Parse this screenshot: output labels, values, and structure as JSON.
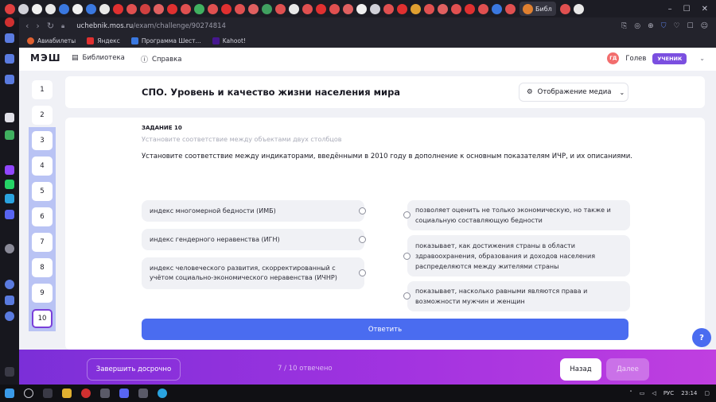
{
  "browser": {
    "active_tab_label": "Библ",
    "url_host": "uchebnik.mos.ru",
    "url_path": "/exam/challenge/90274814",
    "bookmarks": [
      "Авиабилеты",
      "Яндекс",
      "Программа Шест...",
      "Kahoot!"
    ]
  },
  "site": {
    "logo": "МЭШ",
    "nav": {
      "library": "Библиотека",
      "help": "Справка"
    },
    "user": {
      "initials": "ГД",
      "name": "Голев",
      "role": "УЧЕНИК"
    }
  },
  "question_nav": {
    "items": [
      "1",
      "2",
      "3",
      "4",
      "5",
      "6",
      "7",
      "8",
      "9",
      "10"
    ],
    "current": "10"
  },
  "title": "СПО. Уровень и качество жизни населения мира",
  "media_button": "Отображение медиа",
  "task": {
    "label": "ЗАДАНИЕ 10",
    "subtitle": "Установите соответствие между объектами двух столбцов",
    "question": "Установите соответствие между индикаторами, введёнными в 2010 году в дополнение к основным показателям ИЧР, и их описаниями.",
    "left_items": [
      "индекс многомерной бедности (ИМБ)",
      "индекс гендерного неравенства (ИГН)",
      "индекс человеческого развития, скорректированный с учётом социально-экономического неравенства (ИЧНР)"
    ],
    "right_items": [
      "позволяет оценить не только экономическую, но также и социальную составляющую бедности",
      "показывает, как достижения страны в области здравоохранения, образования и доходов населения распределяются между жителями страны",
      "показывает, насколько равными являются права и возможности мужчин и женщин"
    ],
    "submit": "Ответить"
  },
  "help": "?",
  "footer": {
    "finish": "Завершить досрочно",
    "progress": "7 / 10 отвечено",
    "back": "Назад",
    "next": "Далее"
  },
  "taskbar": {
    "lang": "РУС",
    "time": "23:14"
  }
}
